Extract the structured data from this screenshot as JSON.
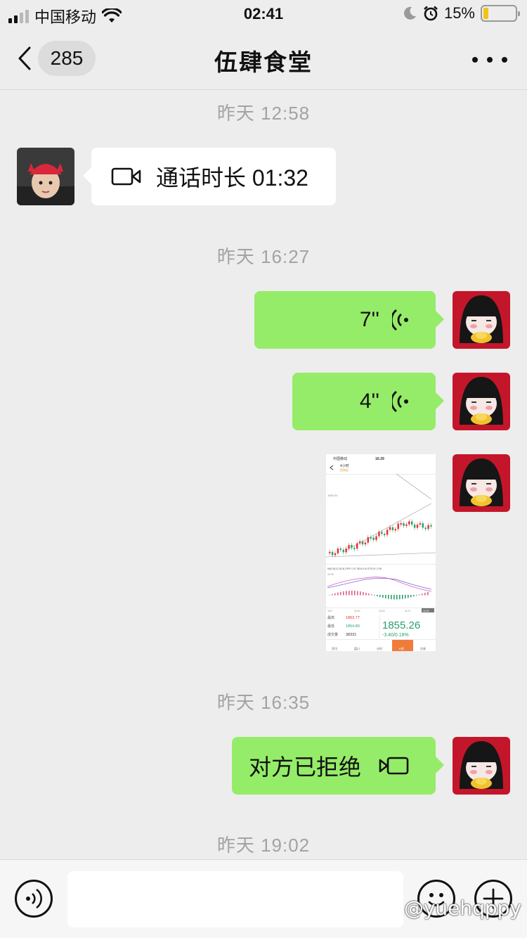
{
  "status_bar": {
    "carrier": "中国移动",
    "time": "02:41",
    "battery_percent": "15%",
    "battery_level": 0.15,
    "colors": {
      "battery": "#f0c419"
    }
  },
  "nav": {
    "unread_count": "285",
    "title": "伍肆食堂"
  },
  "messages": [
    {
      "type": "timestamp",
      "text": "昨天 12:58"
    },
    {
      "type": "video_call",
      "side": "left",
      "icon": "video-camera-icon",
      "text": "通话时长 01:32"
    },
    {
      "type": "timestamp",
      "text": "昨天 16:27"
    },
    {
      "type": "voice",
      "side": "right",
      "duration": "7''",
      "icon": "voice-wave-icon"
    },
    {
      "type": "voice",
      "side": "right",
      "duration": "4''",
      "icon": "voice-wave-icon"
    },
    {
      "type": "image",
      "side": "right",
      "description_icon": "chart-screenshot"
    },
    {
      "type": "timestamp",
      "text": "昨天 16:35"
    },
    {
      "type": "video_call",
      "side": "right",
      "icon": "video-camera-icon",
      "text": "对方已拒绝"
    },
    {
      "type": "timestamp",
      "text": "昨天 19:02"
    }
  ],
  "thumbnail": {
    "carrier": "中国移动",
    "time": "16:29",
    "title": "4小时",
    "subtitle": "招商金",
    "level_label": "1840.00",
    "macd_label": "MACD(12,26,9) DIFF:1.57  DEA:3.04  STICK:-2.96",
    "macd_scale": "10.00",
    "dates": [
      "11/9",
      "11/10",
      "11/13",
      "11/17",
      "11/20"
    ],
    "high_label": "最高",
    "high_value": "1863.77",
    "low_label": "最低",
    "low_value": "1854.80",
    "volume_label": "成交量",
    "volume_value": "38331",
    "price": "1855.26",
    "change": "-3.40/0.18%",
    "tabs": [
      "资讯",
      "盘口",
      "分时",
      "K线",
      "交易"
    ]
  },
  "input_bar": {
    "watermark": "@yuehqppy",
    "icons": [
      "voice-input-icon",
      "emoji-icon",
      "plus-icon"
    ]
  }
}
